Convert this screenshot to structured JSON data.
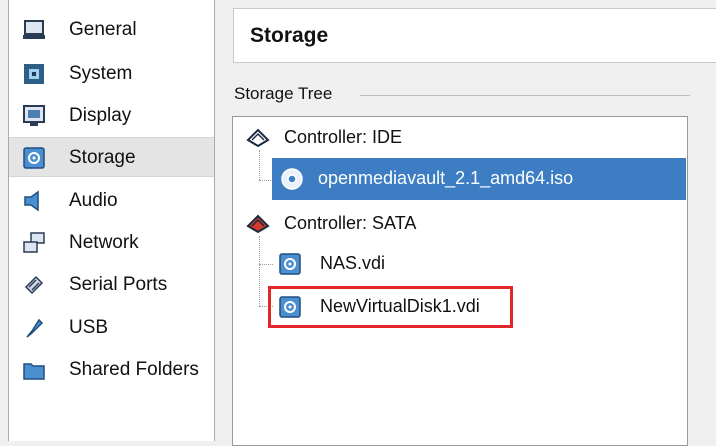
{
  "sidebar": {
    "items": [
      {
        "label": "General",
        "icon": "general-icon"
      },
      {
        "label": "System",
        "icon": "system-icon"
      },
      {
        "label": "Display",
        "icon": "display-icon"
      },
      {
        "label": "Storage",
        "icon": "storage-icon",
        "selected": true
      },
      {
        "label": "Audio",
        "icon": "audio-icon"
      },
      {
        "label": "Network",
        "icon": "network-icon"
      },
      {
        "label": "Serial Ports",
        "icon": "serial-ports-icon"
      },
      {
        "label": "USB",
        "icon": "usb-icon"
      },
      {
        "label": "Shared Folders",
        "icon": "shared-folders-icon"
      }
    ]
  },
  "main": {
    "title": "Storage",
    "tree_caption": "Storage Tree",
    "tree": {
      "ide_controller": "Controller: IDE",
      "ide_disk": "openmediavault_2.1_amd64.iso",
      "sata_controller": "Controller: SATA",
      "sata_disks": [
        "NAS.vdi",
        "NewVirtualDisk1.vdi"
      ]
    }
  },
  "colors": {
    "selection": "#3c7dc3",
    "highlight": "#e2262a",
    "sidebar_selected": "#e4e4e4"
  }
}
